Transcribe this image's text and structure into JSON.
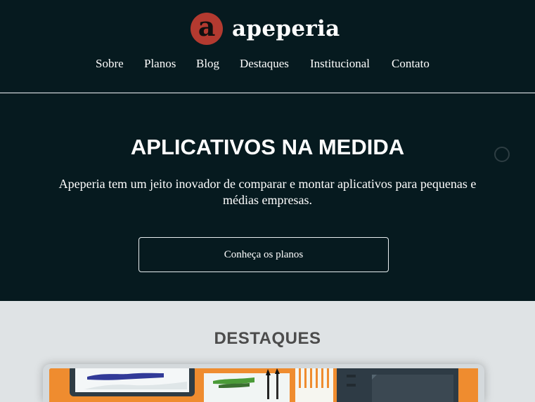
{
  "header": {
    "brand_initial": "a",
    "brand_name": "apeperia",
    "nav": [
      {
        "label": "Sobre"
      },
      {
        "label": "Planos"
      },
      {
        "label": "Blog"
      },
      {
        "label": "Destaques"
      },
      {
        "label": "Institucional"
      },
      {
        "label": "Contato"
      }
    ]
  },
  "hero": {
    "title": "APLICATIVOS NA MEDIDA",
    "text": "Apeperia tem um jeito inovador de comparar e montar aplicativos para pequenas e médias empresas.",
    "button_label": "Conheça os planos"
  },
  "featured": {
    "title": "DESTAQUES"
  },
  "colors": {
    "dark_background": "#061a1f",
    "brand_red": "#b33a30",
    "light_background": "#dfe3e5",
    "section_title": "#4c4c4c",
    "featured_orange": "#ef8c2f"
  },
  "icons": {
    "logo": "circle-letter-a-icon",
    "slider_dot": "circle-outline-icon"
  }
}
